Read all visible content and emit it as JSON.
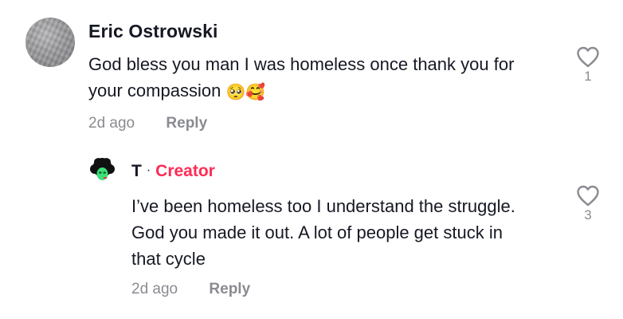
{
  "comment": {
    "username": "Eric Ostrowski",
    "text_line1": "God bless you man I was homeless once thank you for",
    "text_line2": "your compassion",
    "emojis": "🥺🥰",
    "timestamp": "2d ago",
    "reply_label": "Reply",
    "like_count": "1",
    "like_icon": "heart-outline-icon"
  },
  "reply": {
    "username": "T",
    "separator": "·",
    "badge": "Creator",
    "badge_color": "#fe2c55",
    "text_line1": "I’ve been homeless too I understand the struggle.",
    "text_line2": "God you made it out. A lot of people get stuck in",
    "text_line3": "that cycle",
    "timestamp": "2d ago",
    "reply_label": "Reply",
    "like_count": "3",
    "like_icon": "heart-outline-icon"
  }
}
